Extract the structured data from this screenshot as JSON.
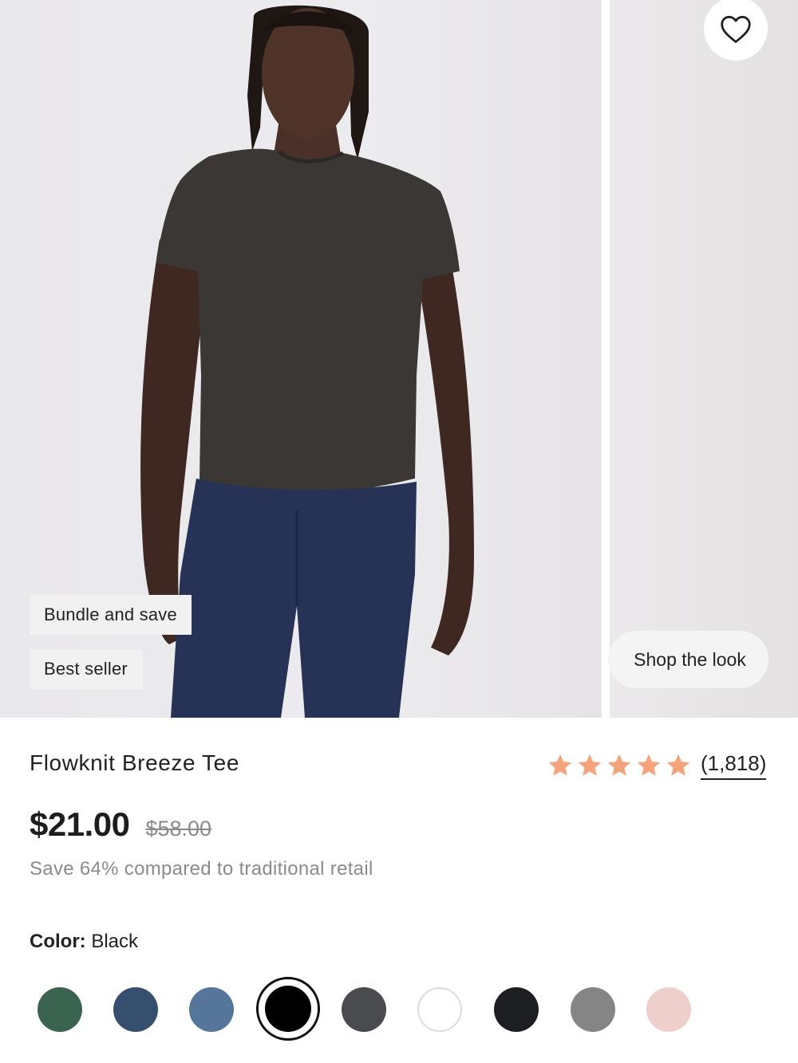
{
  "gallery": {
    "badges": [
      "Bundle and save",
      "Best seller"
    ],
    "shop_the_look_label": "Shop the look",
    "favorite_icon": "heart-outline-icon"
  },
  "product": {
    "title": "Flowknit Breeze Tee",
    "rating": {
      "stars": 5,
      "count_label": "(1,818)",
      "star_color": "#f4a37a"
    },
    "price": "$21.00",
    "compare_price": "$58.00",
    "savings_text": "Save 64% compared to traditional retail",
    "color": {
      "label": "Color:",
      "value": "Black"
    }
  },
  "swatches": [
    {
      "name": "swatch-green",
      "color": "#3b6450",
      "selected": false
    },
    {
      "name": "swatch-navy",
      "color": "#364f6e",
      "selected": false
    },
    {
      "name": "swatch-blue",
      "color": "#55769a",
      "selected": false
    },
    {
      "name": "swatch-black",
      "color": "#000000",
      "selected": true
    },
    {
      "name": "swatch-charcoal",
      "color": "#4a4b4e",
      "selected": false
    },
    {
      "name": "swatch-white",
      "color": "#ffffff",
      "selected": false
    },
    {
      "name": "swatch-jet",
      "color": "#1d1e22",
      "selected": false
    },
    {
      "name": "swatch-grey",
      "color": "#858585",
      "selected": false
    },
    {
      "name": "swatch-blush",
      "color": "#efcfcc",
      "selected": false
    }
  ]
}
